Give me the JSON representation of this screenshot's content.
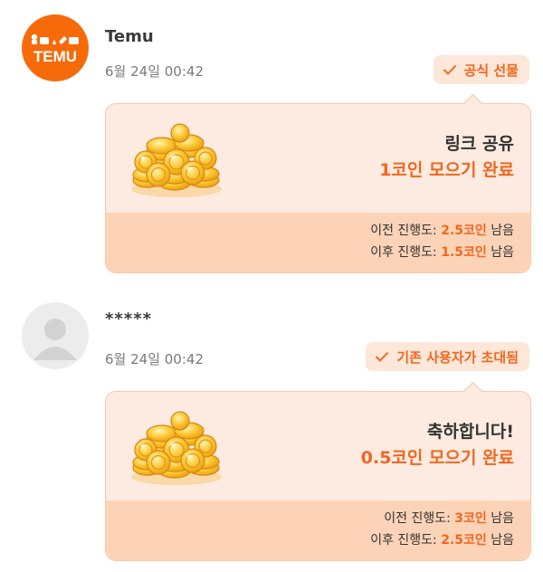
{
  "colors": {
    "brand": "#f76a0a",
    "accent": "#f2661f",
    "tag_bg": "#fde7d9",
    "card_bg": "#fdebe1",
    "card_footer_bg": "#fcd3b7"
  },
  "messages": [
    {
      "sender": "Temu",
      "avatar_logo": "TEMU",
      "time": "6월 24일 00:42",
      "tag": "공식 선물",
      "tag_icon": "check-icon",
      "card": {
        "icon": "gold-coins-icon",
        "line1": "링크 공유",
        "line2": "1코인 모으기 완료",
        "before_label": "이전 진행도:",
        "before_value": "2.5코인",
        "after_label": "이후 진행도:",
        "after_value": "1.5코인",
        "remaining": "남음"
      }
    },
    {
      "sender": "*****",
      "avatar_logo": "",
      "time": "6월 24일 00:42",
      "tag": "기존 사용자가 초대됨",
      "tag_icon": "check-icon",
      "card": {
        "icon": "gold-coins-icon",
        "line1": "축하합니다!",
        "line2": "0.5코인 모으기 완료",
        "before_label": "이전 진행도:",
        "before_value": "3코인",
        "after_label": "이후 진행도:",
        "after_value": "2.5코인",
        "remaining": "남음"
      }
    }
  ]
}
